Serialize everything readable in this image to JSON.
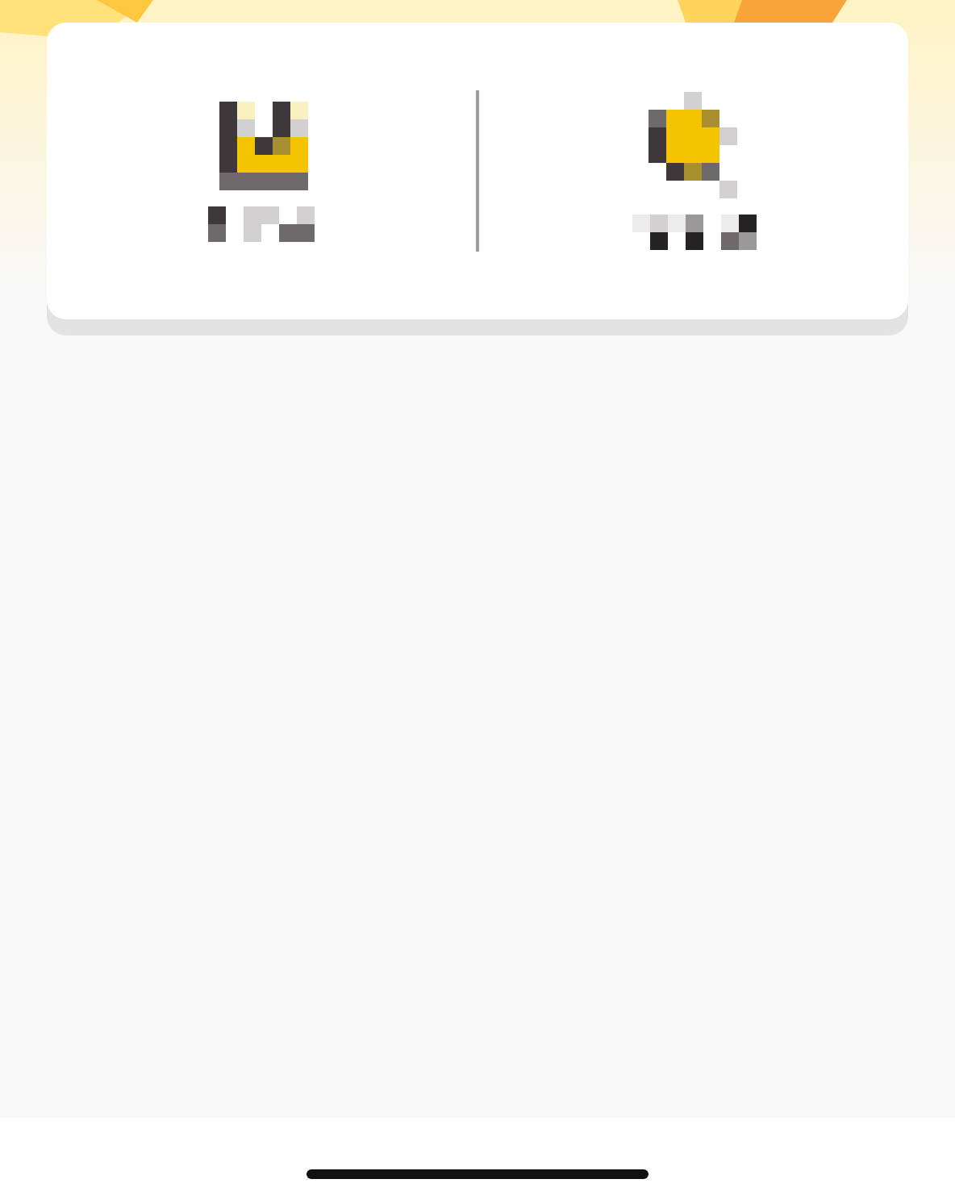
{
  "header": {
    "kind": "banner"
  },
  "home_indicator": {
    "kind": "bar"
  }
}
